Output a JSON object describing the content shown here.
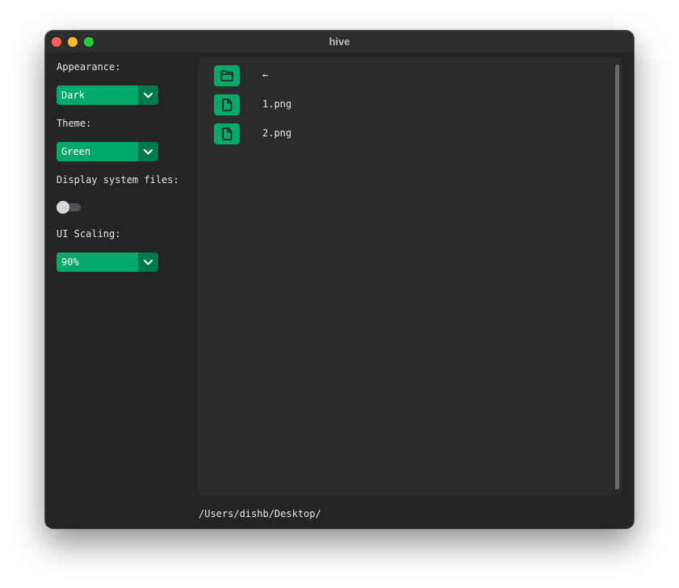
{
  "window": {
    "title": "hive"
  },
  "sidebar": {
    "appearance": {
      "label": "Appearance:",
      "value": "Dark"
    },
    "theme": {
      "label": "Theme:",
      "value": "Green"
    },
    "system_files": {
      "label": "Display system files:",
      "enabled": false
    },
    "scaling": {
      "label": "UI Scaling:",
      "value": "90%"
    }
  },
  "files": {
    "items": [
      {
        "name": "←",
        "icon": "folder-icon"
      },
      {
        "name": "1.png",
        "icon": "file-icon"
      },
      {
        "name": "2.png",
        "icon": "file-icon"
      }
    ]
  },
  "footer": {
    "path": "/Users/dishb/Desktop/"
  },
  "colors": {
    "accent": "#02a96b",
    "accent_dark": "#027a4e",
    "window_bg": "#242424",
    "panel_bg": "#2b2b2b"
  }
}
